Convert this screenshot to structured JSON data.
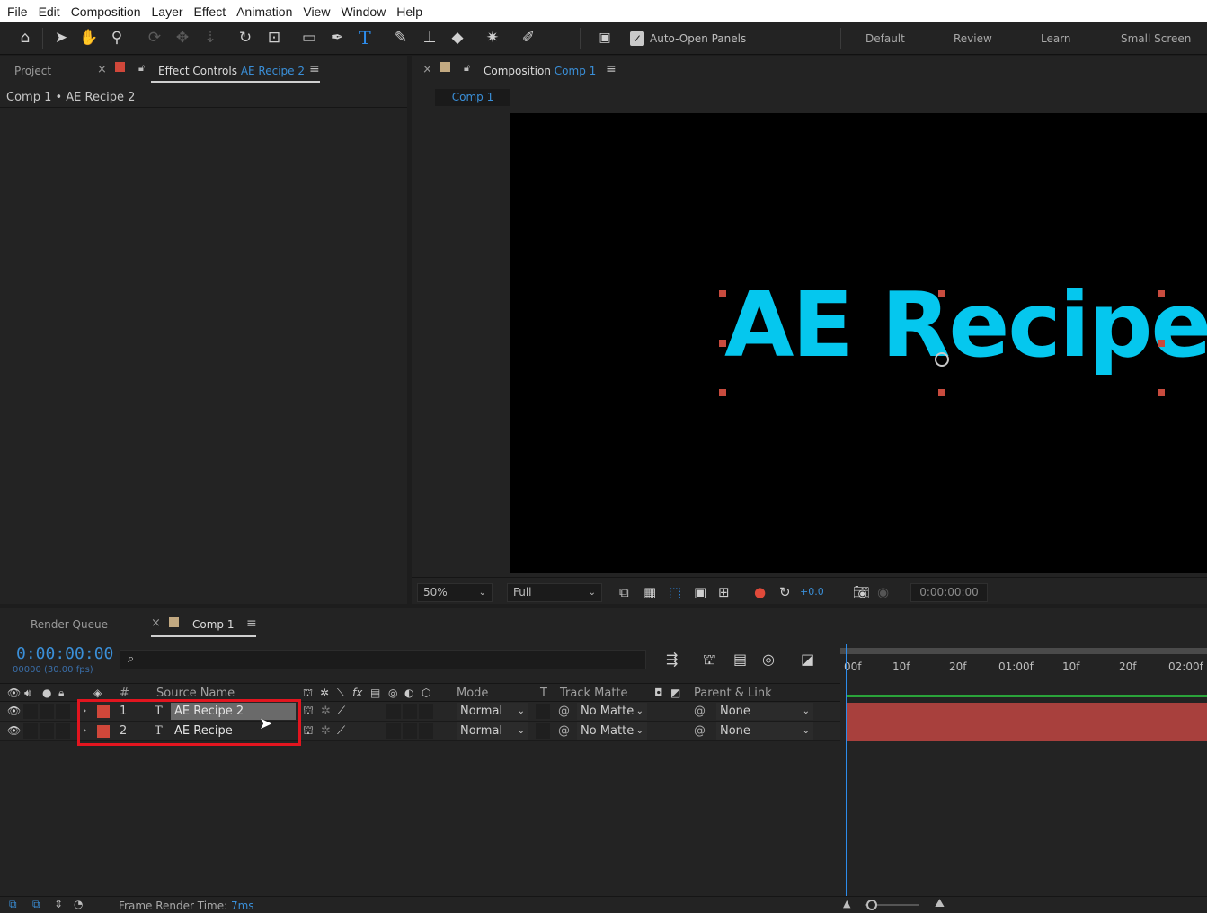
{
  "menu": [
    "File",
    "Edit",
    "Composition",
    "Layer",
    "Effect",
    "Animation",
    "View",
    "Window",
    "Help"
  ],
  "toolbar": {
    "auto_open_label": "Auto-Open Panels",
    "workspaces": [
      "Default",
      "Review",
      "Learn",
      "Small Screen"
    ],
    "active_tool": "text-tool"
  },
  "left_panel": {
    "project_tab": "Project",
    "effect_controls_tab": "Effect Controls",
    "effect_controls_layer": "AE Recipe 2",
    "header": "Comp 1 • AE Recipe 2"
  },
  "comp_panel": {
    "tab_label": "Composition",
    "comp_name": "Comp 1",
    "subtab": "Comp 1",
    "viewer_text": "AE Recipe",
    "text_color": "#05c7ee",
    "zoom": "50%",
    "resolution": "Full",
    "exposure": "+0.0",
    "timecode": "0:00:00:00"
  },
  "timeline": {
    "render_queue_tab": "Render Queue",
    "comp_tab": "Comp 1",
    "current_time": "0:00:00:00",
    "frame_info": "00000 (30.00 fps)",
    "search_placeholder": "⌕",
    "columns": {
      "num": "#",
      "source_name": "Source Name",
      "mode": "Mode",
      "t": "T",
      "track_matte": "Track Matte",
      "parent": "Parent & Link"
    },
    "layers": [
      {
        "num": "1",
        "name": "AE Recipe 2",
        "mode": "Normal",
        "matte": "No Matte",
        "parent": "None",
        "selected": true
      },
      {
        "num": "2",
        "name": "AE Recipe",
        "mode": "Normal",
        "matte": "No Matte",
        "parent": "None",
        "selected": false
      }
    ],
    "ruler_ticks": [
      "00f",
      "10f",
      "20f",
      "01:00f",
      "10f",
      "20f",
      "02:00f"
    ]
  },
  "status": {
    "frame_render_label": "Frame Render Time:",
    "frame_render_value": "7ms"
  },
  "colors": {
    "accent_blue": "#2d8ceb",
    "layer_label_red": "#d0473a",
    "highlight_box": "#e2151f"
  }
}
